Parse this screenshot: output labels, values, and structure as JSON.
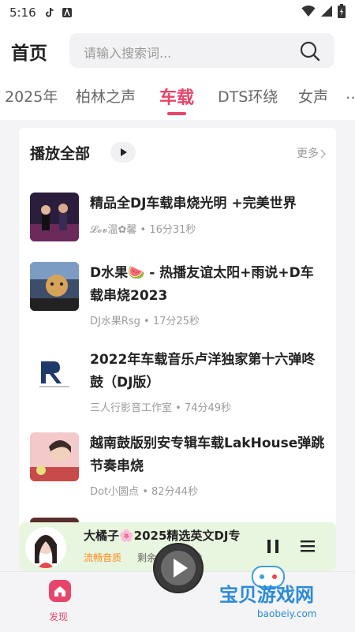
{
  "status_bar": {
    "time": "5:16"
  },
  "header": {
    "title": "首页",
    "search_placeholder": "请输入搜索词..."
  },
  "tabs": [
    {
      "label": "2025年"
    },
    {
      "label": "柏林之声"
    },
    {
      "label": "车载",
      "active": true
    },
    {
      "label": "DTS环绕"
    },
    {
      "label": "女声"
    }
  ],
  "section": {
    "title": "播放全部",
    "more": "更多"
  },
  "items": [
    {
      "title": "精品全DJ车载串烧光明 +完美世界",
      "meta": "𝓛𝓸𝓿温✿馨 • 16分31秒"
    },
    {
      "title": "D水果🍉 - 热播友谊太阳+雨说+D车载串烧2023",
      "meta": "DJ水果Rsg • 17分25秒"
    },
    {
      "title": "2022年车载音乐卢洋独家第十六弹咚鼓（DJ版）",
      "meta": "三人行影音工作室 • 74分49秒"
    },
    {
      "title": "越南鼓版别安专辑车载LakHouse弹跳节奏串烧",
      "meta": "Dot小圆点 • 82分44秒"
    }
  ],
  "player": {
    "title": "大橘子🌸2025精选英文DJ专",
    "quality": "流畅音质",
    "remaining": "剩余 54分18秒"
  },
  "bottom_nav": {
    "home_label": "发现"
  },
  "watermark": {
    "text": "宝贝游戏网",
    "domain": "baobeiy.com"
  },
  "colors": {
    "accent": "#e8456a",
    "player_bg": "#e8f5df",
    "quality": "#ff8c1a"
  }
}
